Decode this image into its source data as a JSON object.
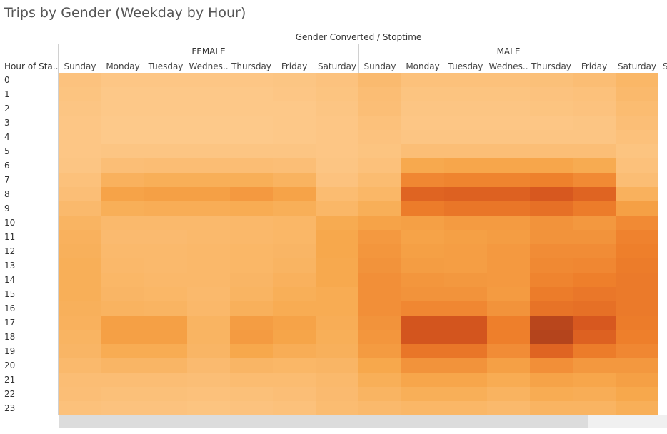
{
  "title": "Trips by Gender (Weekday by Hour)",
  "column_header": "Gender Converted / Stoptime",
  "row_header": "Hour of Sta..",
  "genders": [
    "FEMALE",
    "MALE"
  ],
  "days": [
    "Sunday",
    "Monday",
    "Tuesday",
    "Wednes..",
    "Thursday",
    "Friday",
    "Saturday"
  ],
  "hours": [
    "0",
    "1",
    "2",
    "3",
    "4",
    "5",
    "6",
    "7",
    "8",
    "9",
    "10",
    "11",
    "12",
    "13",
    "14",
    "15",
    "16",
    "17",
    "18",
    "19",
    "20",
    "21",
    "22",
    "23"
  ],
  "extra_column_label": "S",
  "colors": {
    "low": "#fdc98a",
    "high": "#a33a1a",
    "grid_line": "#d0d0d0"
  },
  "chart_data": {
    "type": "heatmap",
    "title": "Trips by Gender (Weekday by Hour)",
    "x_title": "Gender Converted / Stoptime",
    "y_title": "Hour of Sta..",
    "x_groups": [
      "FEMALE",
      "MALE"
    ],
    "x_categories": [
      "Sunday",
      "Monday",
      "Tuesday",
      "Wednes..",
      "Thursday",
      "Friday",
      "Saturday"
    ],
    "y_categories": [
      "0",
      "1",
      "2",
      "3",
      "4",
      "5",
      "6",
      "7",
      "8",
      "9",
      "10",
      "11",
      "12",
      "13",
      "14",
      "15",
      "16",
      "17",
      "18",
      "19",
      "20",
      "21",
      "22",
      "23"
    ],
    "intensity_scale": [
      0,
      1
    ],
    "values": {
      "FEMALE": [
        [
          0.05,
          0.02,
          0.02,
          0.02,
          0.02,
          0.03,
          0.05
        ],
        [
          0.04,
          0.01,
          0.01,
          0.01,
          0.01,
          0.02,
          0.04
        ],
        [
          0.03,
          0.01,
          0.01,
          0.01,
          0.01,
          0.01,
          0.03
        ],
        [
          0.02,
          0.0,
          0.0,
          0.0,
          0.0,
          0.01,
          0.02
        ],
        [
          0.02,
          0.0,
          0.0,
          0.0,
          0.0,
          0.01,
          0.02
        ],
        [
          0.02,
          0.03,
          0.03,
          0.03,
          0.03,
          0.03,
          0.02
        ],
        [
          0.03,
          0.08,
          0.09,
          0.09,
          0.09,
          0.08,
          0.03
        ],
        [
          0.06,
          0.18,
          0.2,
          0.2,
          0.2,
          0.17,
          0.05
        ],
        [
          0.08,
          0.28,
          0.3,
          0.3,
          0.34,
          0.28,
          0.1
        ],
        [
          0.12,
          0.2,
          0.21,
          0.21,
          0.22,
          0.2,
          0.14
        ],
        [
          0.16,
          0.12,
          0.12,
          0.12,
          0.13,
          0.14,
          0.23
        ],
        [
          0.18,
          0.11,
          0.11,
          0.12,
          0.13,
          0.14,
          0.25
        ],
        [
          0.19,
          0.12,
          0.12,
          0.13,
          0.14,
          0.15,
          0.25
        ],
        [
          0.2,
          0.13,
          0.12,
          0.13,
          0.14,
          0.16,
          0.24
        ],
        [
          0.2,
          0.14,
          0.13,
          0.13,
          0.15,
          0.18,
          0.24
        ],
        [
          0.2,
          0.15,
          0.14,
          0.12,
          0.16,
          0.2,
          0.22
        ],
        [
          0.19,
          0.17,
          0.16,
          0.13,
          0.19,
          0.22,
          0.22
        ],
        [
          0.18,
          0.3,
          0.3,
          0.16,
          0.32,
          0.28,
          0.21
        ],
        [
          0.16,
          0.3,
          0.3,
          0.16,
          0.33,
          0.27,
          0.2
        ],
        [
          0.15,
          0.22,
          0.22,
          0.15,
          0.25,
          0.21,
          0.19
        ],
        [
          0.12,
          0.15,
          0.15,
          0.11,
          0.15,
          0.14,
          0.15
        ],
        [
          0.09,
          0.09,
          0.09,
          0.08,
          0.1,
          0.1,
          0.12
        ],
        [
          0.08,
          0.07,
          0.07,
          0.06,
          0.07,
          0.08,
          0.11
        ],
        [
          0.06,
          0.05,
          0.05,
          0.04,
          0.05,
          0.06,
          0.1
        ]
      ],
      "MALE": [
        [
          0.11,
          0.06,
          0.06,
          0.06,
          0.07,
          0.09,
          0.14
        ],
        [
          0.09,
          0.04,
          0.04,
          0.04,
          0.05,
          0.06,
          0.12
        ],
        [
          0.08,
          0.03,
          0.03,
          0.03,
          0.04,
          0.05,
          0.1
        ],
        [
          0.06,
          0.02,
          0.02,
          0.02,
          0.02,
          0.03,
          0.08
        ],
        [
          0.05,
          0.03,
          0.03,
          0.03,
          0.03,
          0.03,
          0.06
        ],
        [
          0.04,
          0.08,
          0.08,
          0.08,
          0.08,
          0.08,
          0.04
        ],
        [
          0.06,
          0.24,
          0.26,
          0.26,
          0.26,
          0.23,
          0.06
        ],
        [
          0.1,
          0.45,
          0.47,
          0.47,
          0.49,
          0.43,
          0.09
        ],
        [
          0.14,
          0.68,
          0.7,
          0.7,
          0.76,
          0.68,
          0.18
        ],
        [
          0.2,
          0.52,
          0.56,
          0.56,
          0.6,
          0.52,
          0.3
        ],
        [
          0.28,
          0.3,
          0.33,
          0.33,
          0.38,
          0.35,
          0.43
        ],
        [
          0.34,
          0.28,
          0.3,
          0.32,
          0.38,
          0.38,
          0.48
        ],
        [
          0.36,
          0.3,
          0.31,
          0.34,
          0.42,
          0.42,
          0.5
        ],
        [
          0.38,
          0.32,
          0.31,
          0.34,
          0.44,
          0.45,
          0.52
        ],
        [
          0.4,
          0.36,
          0.35,
          0.34,
          0.47,
          0.5,
          0.53
        ],
        [
          0.4,
          0.38,
          0.38,
          0.33,
          0.52,
          0.55,
          0.53
        ],
        [
          0.4,
          0.45,
          0.45,
          0.38,
          0.58,
          0.6,
          0.53
        ],
        [
          0.38,
          0.78,
          0.78,
          0.5,
          0.9,
          0.76,
          0.52
        ],
        [
          0.36,
          0.78,
          0.78,
          0.5,
          0.92,
          0.7,
          0.5
        ],
        [
          0.33,
          0.56,
          0.56,
          0.42,
          0.68,
          0.52,
          0.45
        ],
        [
          0.25,
          0.38,
          0.38,
          0.3,
          0.4,
          0.35,
          0.35
        ],
        [
          0.2,
          0.26,
          0.26,
          0.22,
          0.28,
          0.26,
          0.3
        ],
        [
          0.16,
          0.2,
          0.2,
          0.17,
          0.22,
          0.21,
          0.25
        ],
        [
          0.12,
          0.14,
          0.14,
          0.12,
          0.16,
          0.16,
          0.2
        ]
      ]
    }
  }
}
